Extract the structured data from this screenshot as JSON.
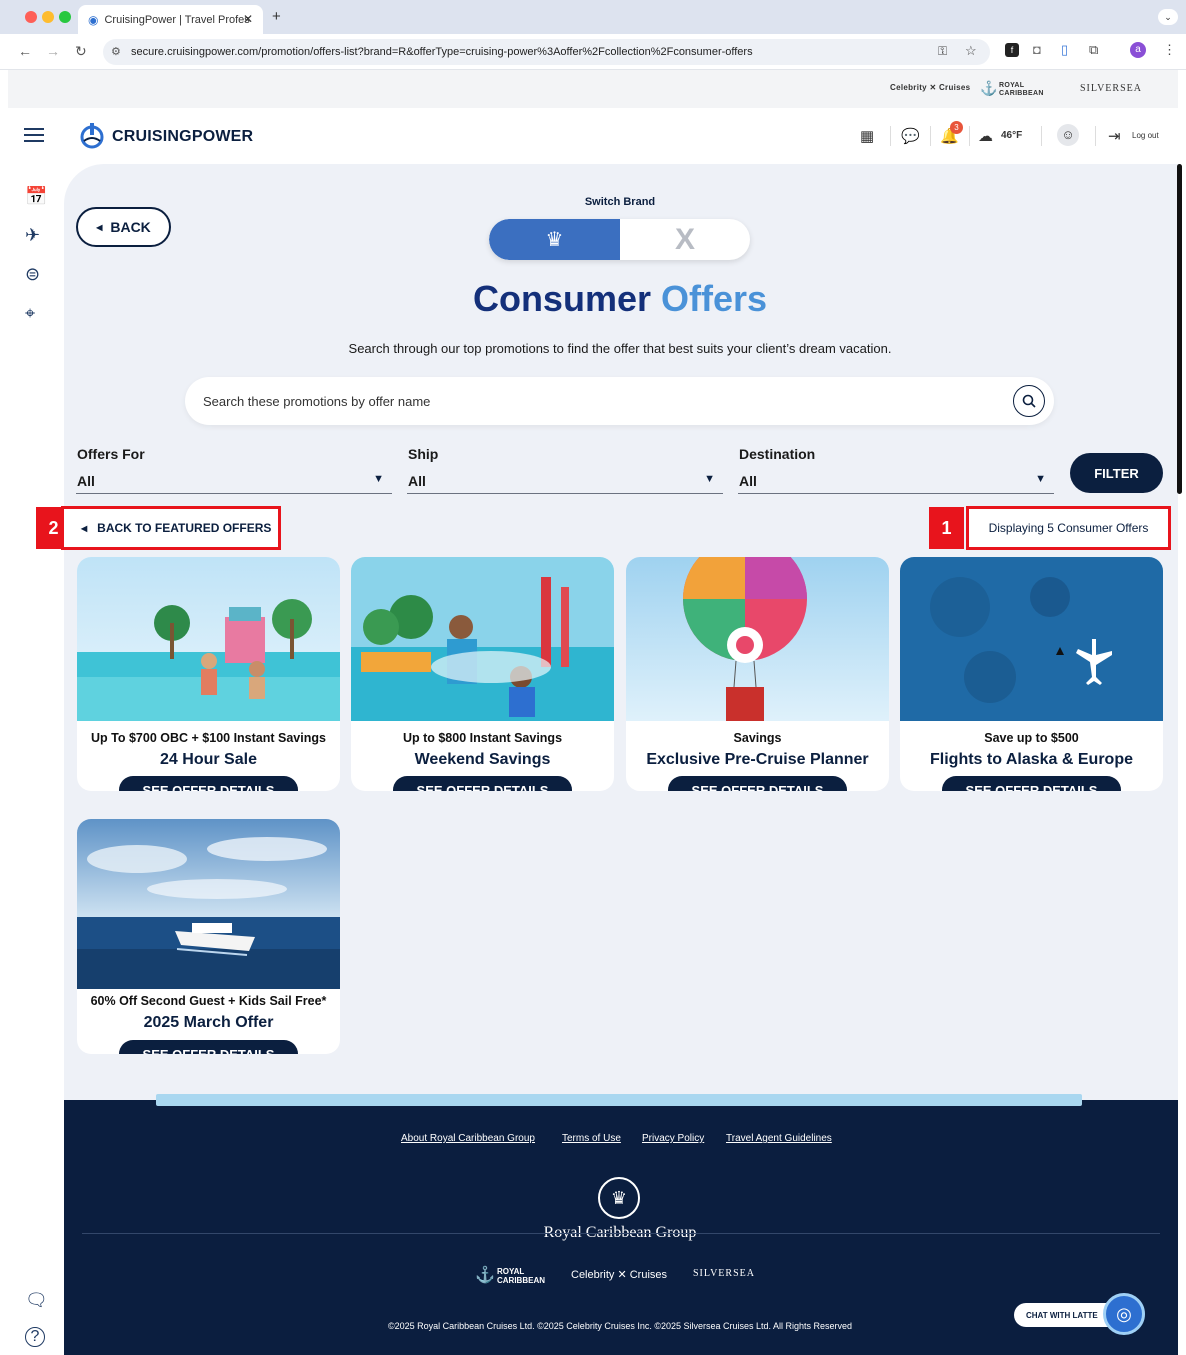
{
  "browser": {
    "tab_title": "CruisingPower | Travel Profes",
    "url": "secure.cruisingpower.com/promotion/offers-list?brand=R&offerType=cruising-power%3Aoffer%2Fcollection%2Fconsumer-offers",
    "profile_initial": "a"
  },
  "brand_strip": {
    "celebrity": "Celebrity ✕ Cruises",
    "royal": "ROYAL CARIBBEAN",
    "silversea": "SILVERSEA"
  },
  "header": {
    "logo_text": "CRUISINGPOWER",
    "notification_count": "3",
    "weather": "46°F",
    "logout": "Log out"
  },
  "page": {
    "back_label": "BACK",
    "switch_label": "Switch Brand",
    "switch_x": "X",
    "title_part1": "Consumer",
    "title_part2": "Offers",
    "subtitle": "Search through our top promotions to find the offer that best suits your client’s dream vacation.",
    "search_placeholder": "Search these promotions by offer name"
  },
  "filters": {
    "offers_for_label": "Offers For",
    "offers_for_value": "All",
    "ship_label": "Ship",
    "ship_value": "All",
    "destination_label": "Destination",
    "destination_value": "All",
    "filter_button": "FILTER"
  },
  "annotations": {
    "marker1": "1",
    "marker2": "2",
    "back_to_featured": "BACK TO FEATURED OFFERS",
    "count_text": "Displaying 5 Consumer Offers"
  },
  "offers": [
    {
      "pre": "Up To $700 OBC + $100 Instant Savings",
      "title": "24 Hour Sale",
      "button": "SEE OFFER DETAILS"
    },
    {
      "pre": "Up to $800 Instant Savings",
      "title": "Weekend Savings",
      "button": "SEE OFFER DETAILS"
    },
    {
      "pre": "Savings",
      "title": "Exclusive Pre-Cruise Planner",
      "button": "SEE OFFER DETAILS"
    },
    {
      "pre": "Save up to $500",
      "title": "Flights to Alaska & Europe",
      "button": "SEE OFFER DETAILS"
    },
    {
      "pre": "60% Off Second Guest + Kids Sail Free*",
      "title": "2025 March Offer",
      "button": "SEE OFFER DETAILS"
    }
  ],
  "footer": {
    "links": [
      "About Royal Caribbean Group",
      "Terms of Use",
      "Privacy Policy",
      "Travel Agent Guidelines"
    ],
    "group_name": "Royal Caribbean Group",
    "brand_royal": "ROYAL CARIBBEAN",
    "brand_celebrity": "Celebrity ✕ Cruises",
    "brand_silversea": "SILVERSEA",
    "copyright": "©2025 Royal Caribbean Cruises Ltd. ©2025 Celebrity Cruises Inc. ©2025 Silversea Cruises Ltd. All Rights Reserved",
    "chat": "CHAT WITH LATTE"
  },
  "colors": {
    "navy": "#0b1f3f",
    "accent_blue": "#3b6fc0",
    "annotation_red": "#e8141c"
  }
}
